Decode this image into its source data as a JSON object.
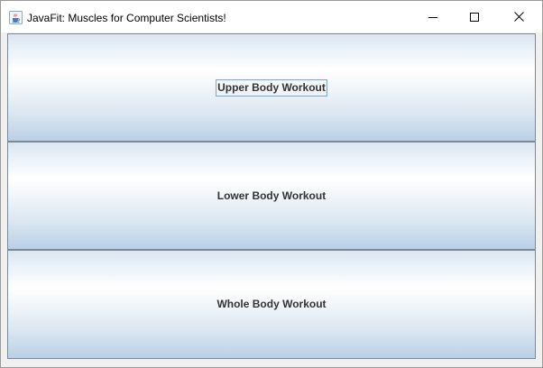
{
  "window": {
    "title": "JavaFit: Muscles for Computer Scientists!",
    "icon": "java-cup-icon"
  },
  "controls": {
    "minimize_icon": "minimize-icon",
    "maximize_icon": "maximize-icon",
    "close_icon": "close-icon"
  },
  "buttons": [
    {
      "label": "Upper Body Workout",
      "focused": true
    },
    {
      "label": "Lower Body Workout",
      "focused": false
    },
    {
      "label": "Whole Body Workout",
      "focused": false
    }
  ],
  "colors": {
    "button_gradient_top": "#ffffff",
    "button_gradient_bottom": "#b9d0e6",
    "focus_outline": "#8aa2bd",
    "label_text": "#333333"
  }
}
